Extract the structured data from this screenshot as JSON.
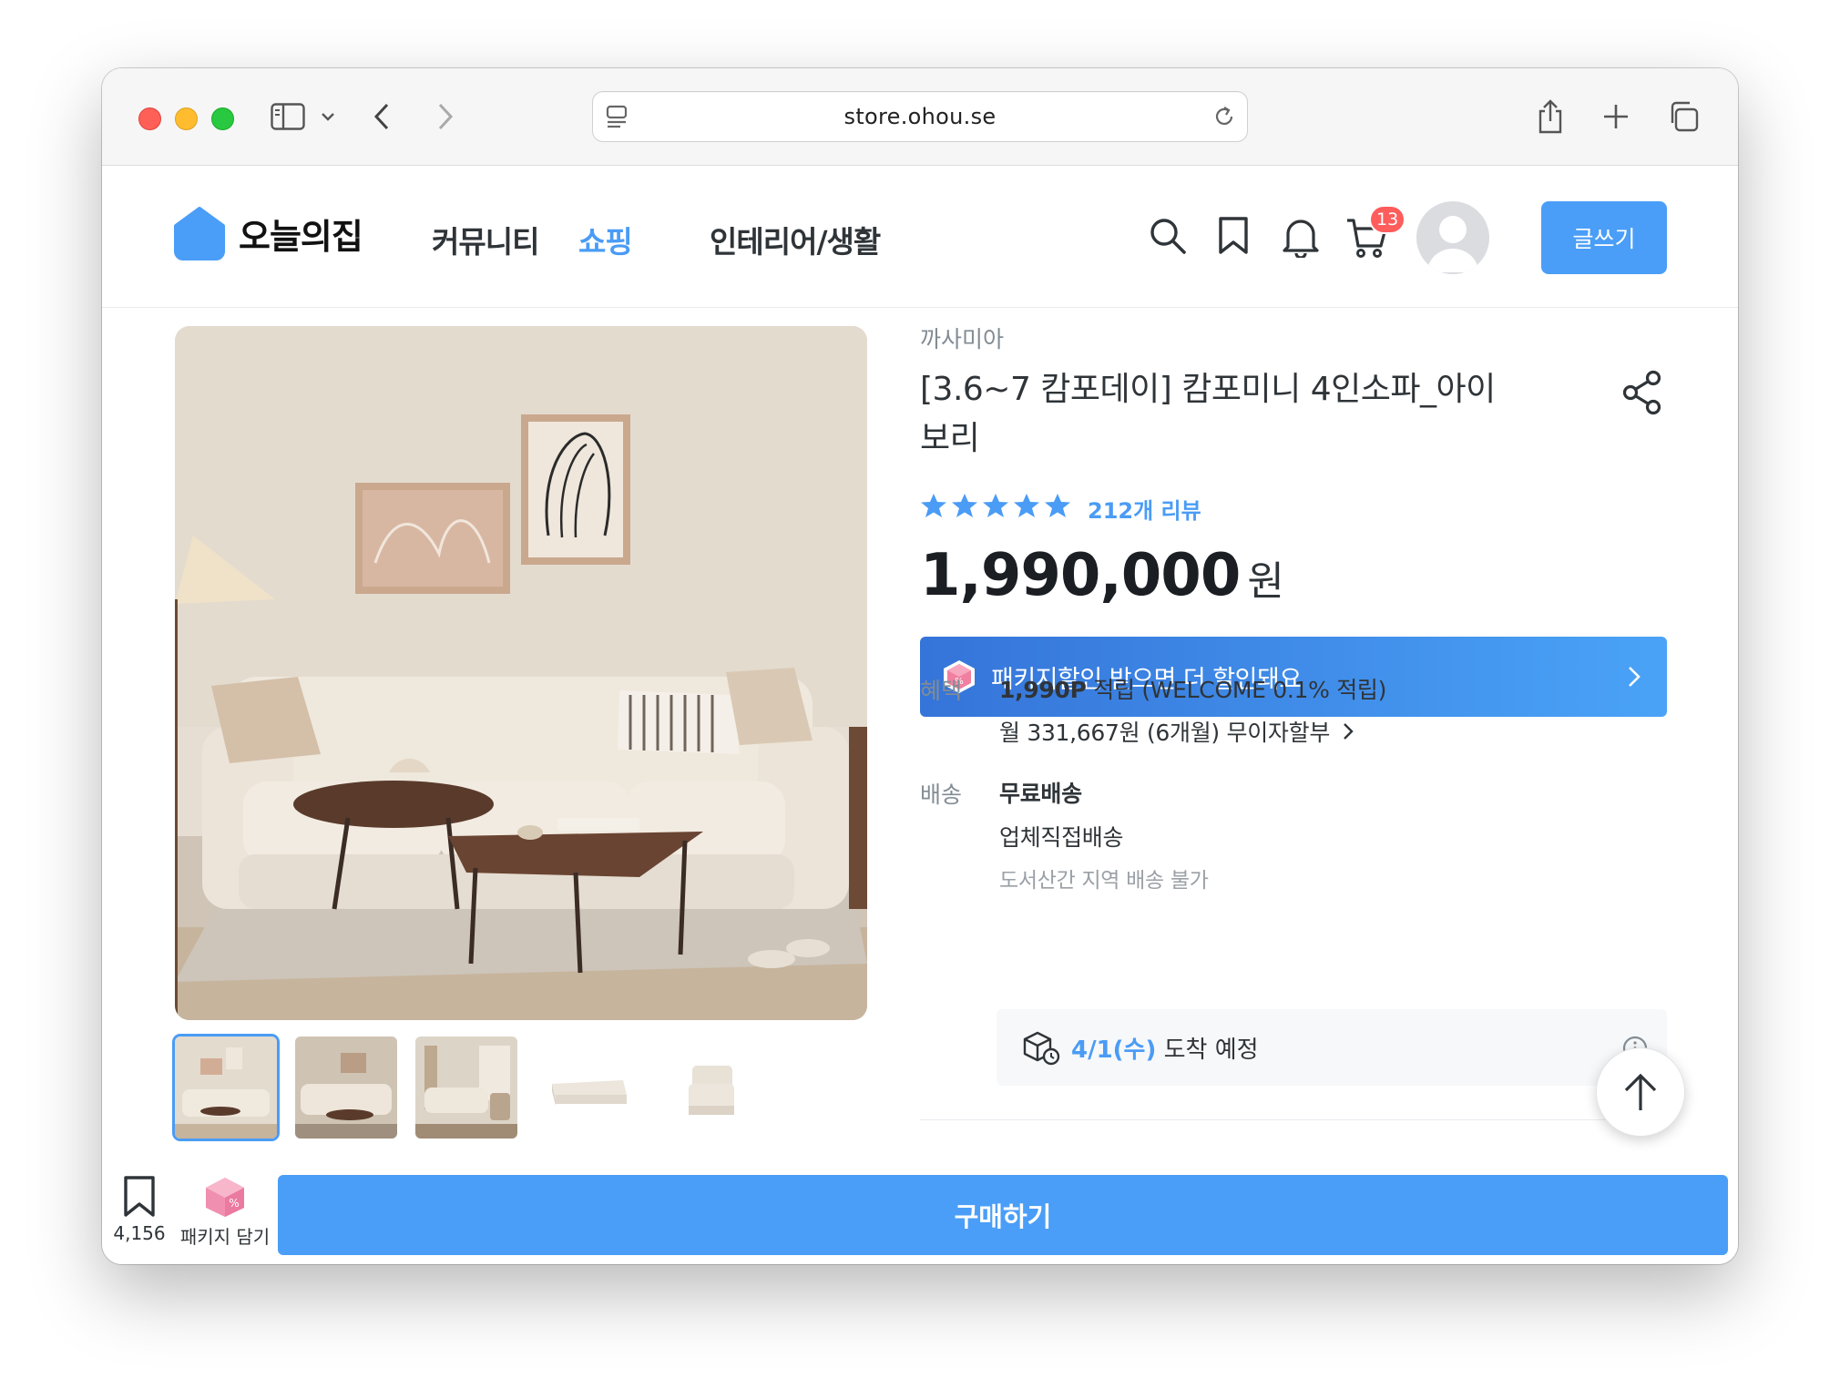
{
  "browser": {
    "url": "store.ohou.se"
  },
  "header": {
    "logo_text": "오늘의집",
    "nav": [
      {
        "label": "커뮤니티",
        "active": false
      },
      {
        "label": "쇼핑",
        "active": true
      },
      {
        "label": "인테리어/생활",
        "active": false
      }
    ],
    "cart_count": "13",
    "write_label": "글쓰기"
  },
  "product": {
    "brand": "까사미아",
    "title": "[3.6~7 캄포데이] 캄포미니 4인소파_아이보리",
    "rating_stars": 5,
    "review_count": "212개 리뷰",
    "price": "1,990,000",
    "price_unit": "원",
    "package_banner": "패키지할인 받으면 더 할인돼요",
    "benefit": {
      "label": "혜택",
      "points": "1,990P",
      "points_suffix": "적립 (WELCOME 0.1% 적립)",
      "installment": "월 331,667원 (6개월) 무이자할부"
    },
    "shipping": {
      "label": "배송",
      "type": "무료배송",
      "method": "업체직접배송",
      "note": "도서산간 지역 배송 불가"
    },
    "arrival": {
      "date": "4/1(수)",
      "suffix": "도착 예정"
    }
  },
  "bottom_bar": {
    "bookmark_count": "4,156",
    "package_label": "패키지 담기",
    "buy_label": "구매하기"
  },
  "colors": {
    "accent": "#4a9cf5",
    "button": "#4a9ef7",
    "badge": "#ff5c5c"
  }
}
